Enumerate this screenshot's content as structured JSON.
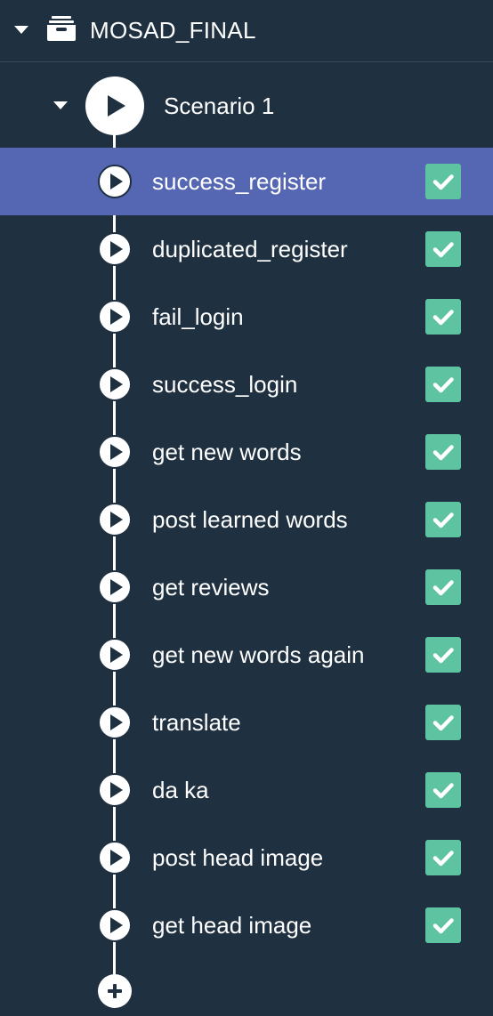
{
  "project": {
    "name": "MOSAD_FINAL",
    "caret_icon": "caret-down-icon",
    "folder_icon": "archive-box-icon"
  },
  "scenario": {
    "name": "Scenario 1",
    "caret_icon": "caret-down-icon",
    "run_icon": "play-circle-icon"
  },
  "colors": {
    "background": "#1f3040",
    "selected_row": "#5566b3",
    "check_badge": "#5ec3a0",
    "divider": "#34495a"
  },
  "cases": [
    {
      "name": "success_register",
      "selected": true,
      "status": "passed"
    },
    {
      "name": "duplicated_register",
      "selected": false,
      "status": "passed"
    },
    {
      "name": "fail_login",
      "selected": false,
      "status": "passed"
    },
    {
      "name": "success_login",
      "selected": false,
      "status": "passed"
    },
    {
      "name": "get new words",
      "selected": false,
      "status": "passed"
    },
    {
      "name": "post learned words",
      "selected": false,
      "status": "passed"
    },
    {
      "name": "get reviews",
      "selected": false,
      "status": "passed"
    },
    {
      "name": "get new words again",
      "selected": false,
      "status": "passed"
    },
    {
      "name": "translate",
      "selected": false,
      "status": "passed"
    },
    {
      "name": "da ka",
      "selected": false,
      "status": "passed"
    },
    {
      "name": "post head image",
      "selected": false,
      "status": "passed"
    },
    {
      "name": "get head image",
      "selected": false,
      "status": "passed"
    }
  ],
  "add_case": {
    "icon": "plus-circle-icon"
  }
}
